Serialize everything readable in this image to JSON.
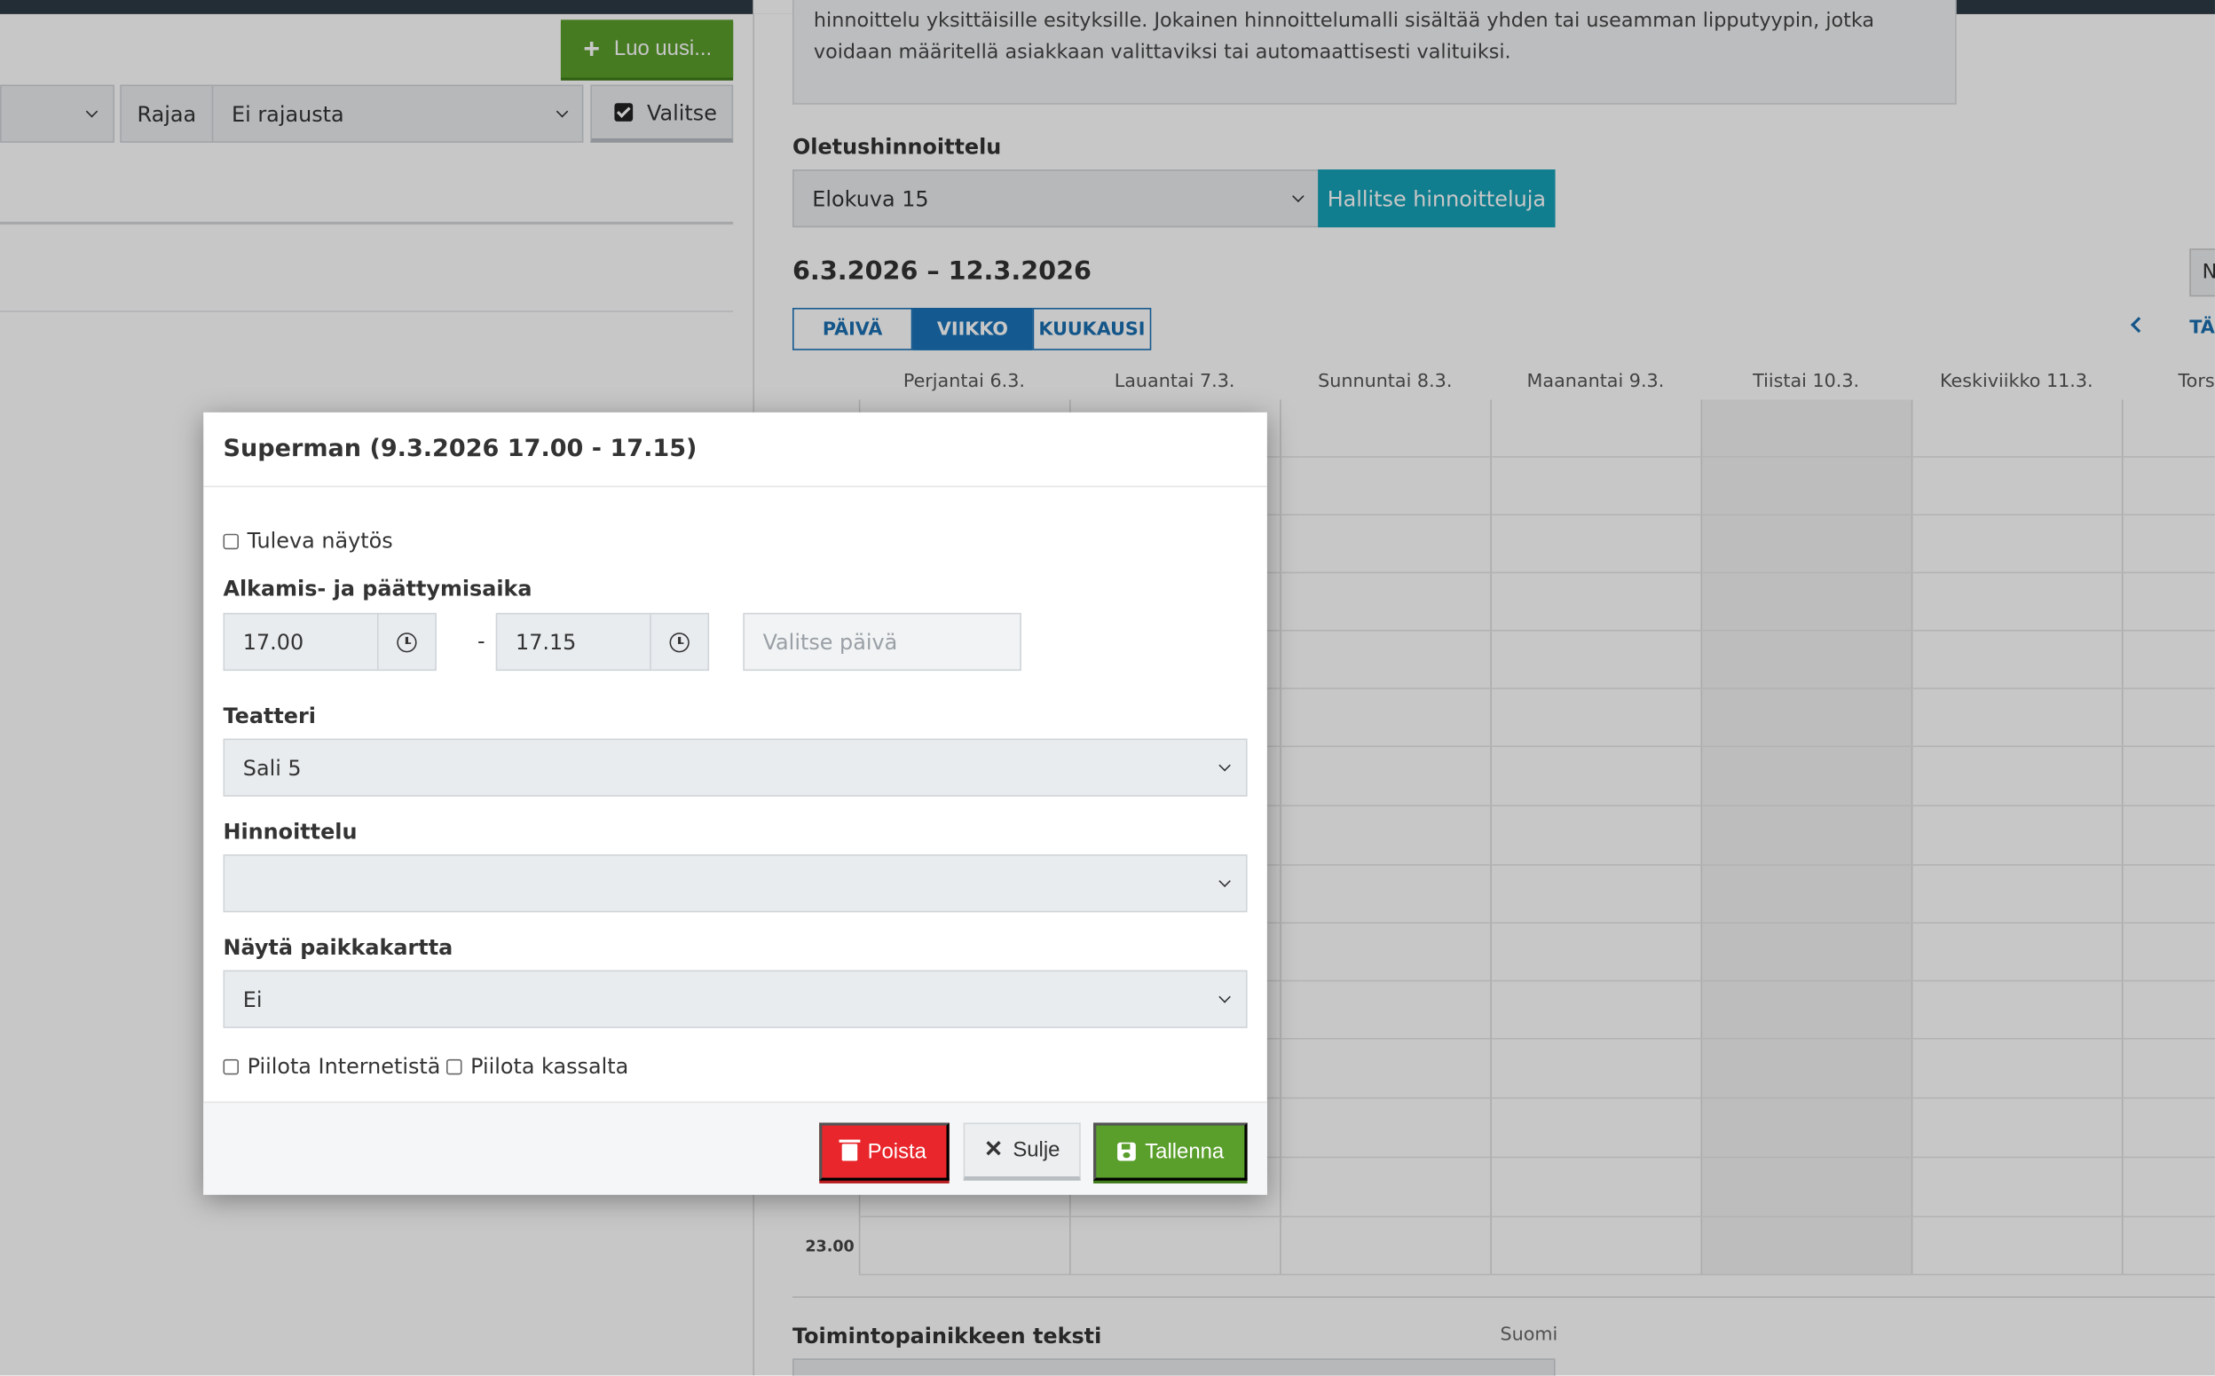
{
  "left": {
    "new_button": "Luo uusi...",
    "filter_label": "Rajaa",
    "filter_value": "Ei rajausta",
    "select_button": "Valitse"
  },
  "right": {
    "info_text": "hinnoittelu yksittäisille esityksille. Jokainen hinnoittelumalli sisältää yhden tai useamman lipputyypin, jotka voidaan määritellä asiakkaan valittaviksi tai automaattisesti valituiksi.",
    "default_pricing_label": "Oletushinnoittelu",
    "default_pricing_value": "Elokuva 15",
    "manage_pricing_button": "Hallitse hinnoitteluja",
    "date_range": "6.3.2026 – 12.3.2026",
    "n_button": "N",
    "views": [
      "PÄIVÄ",
      "VIIKKO",
      "KUUKAUSI"
    ],
    "active_view": "VIIKKO",
    "today_link": "TÄ",
    "days": [
      "Perjantai 6.3.",
      "Lauantai 7.3.",
      "Sunnuntai 8.3.",
      "Maanantai 9.3.",
      "Tiistai 10.3.",
      "Keskiviikko 11.3.",
      "Tors"
    ],
    "time_label": "23.00",
    "action_text_label": "Toimintopainikkeen teksti",
    "language": "Suomi"
  },
  "modal": {
    "title": "Superman (9.3.2026 17.00 - 17.15)",
    "upcoming_label": "Tuleva näytös",
    "time_label": "Alkamis- ja päättymisaika",
    "start_time": "17.00",
    "separator": "-",
    "end_time": "17.15",
    "date_placeholder": "Valitse päivä",
    "theater_label": "Teatteri",
    "theater_value": "Sali 5",
    "pricing_label": "Hinnoittelu",
    "pricing_value": "",
    "seatmap_label": "Näytä paikkakartta",
    "seatmap_value": "Ei",
    "hide_internet_label": "Piilota Internetistä",
    "hide_cashier_label": "Piilota kassalta",
    "delete_button": "Poista",
    "close_button": "Sulje",
    "save_button": "Tallenna"
  },
  "colors": {
    "primary_green": "#5a9e2c",
    "info_cyan": "#17a2b8",
    "danger_red": "#e8262b",
    "tab_blue": "#1a73b8"
  }
}
